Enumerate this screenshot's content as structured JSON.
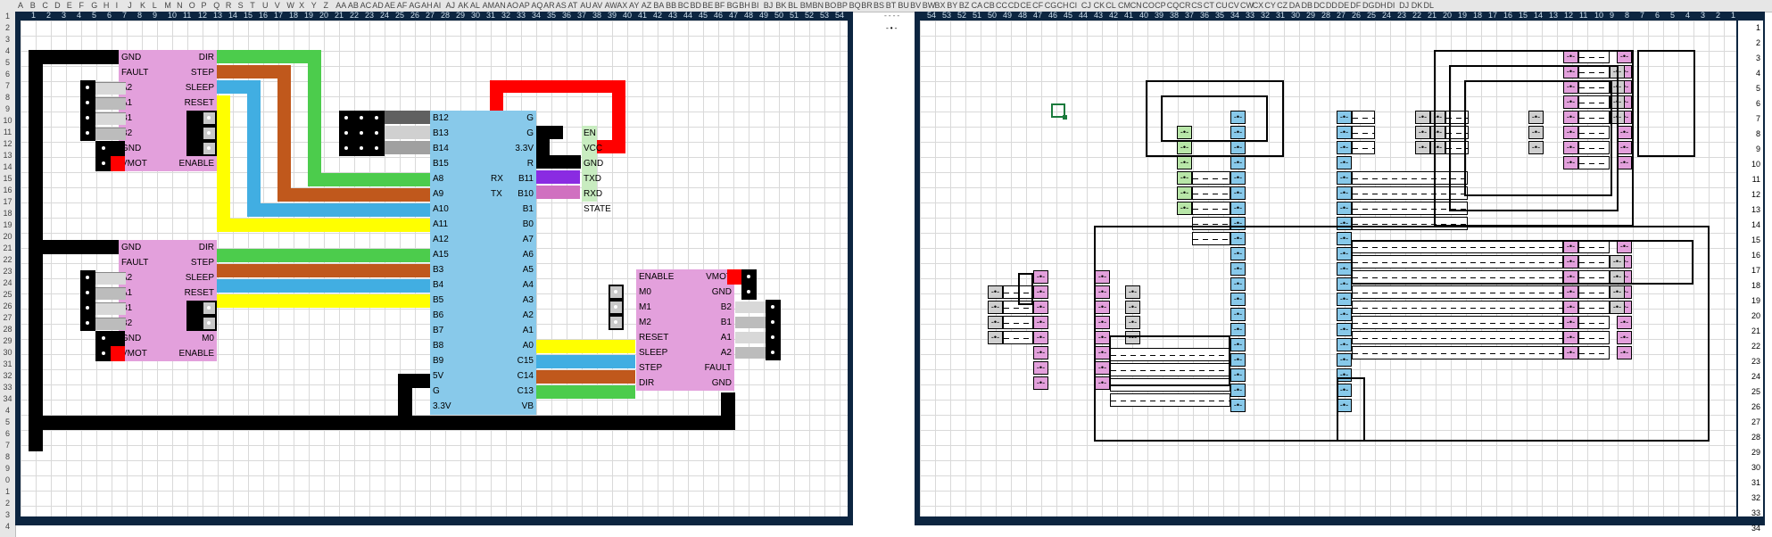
{
  "sheet": {
    "column_headers_text": "A B C D E F G H I J K L M N O P Q R S T U V W X Y Z AA AB AC AD AE AF AG AH AI AJ AK AL AM AN AO AP AQ AR AS AT AU AV AW AX AY AZ BA BB BC BD BE BF BG BH BI BJ BK BL BM BN BO BP BQ BR BS BT BU BV BW BX BY BZ CA CB CC CD CE CF CG CH CI CJ CK CL CM CN CO CP CQ CR CS CT CU CV CW CX CY CZ DA DB DC DD DE DF DG DH DI DJ DK DL",
    "row_headers": [
      "1",
      "2",
      "3",
      "4",
      "5",
      "6",
      "7",
      "8",
      "9",
      "10",
      "11",
      "12",
      "13",
      "14",
      "15",
      "16",
      "17",
      "18",
      "19",
      "20",
      "21",
      "22",
      "23",
      "24",
      "25",
      "26",
      "27",
      "28",
      "29",
      "30",
      "31",
      "32",
      "33",
      "34"
    ],
    "side_cell_text": "----",
    "side_cell_mark": "-•-"
  },
  "left_panel": {
    "numbers": [
      "1",
      "2",
      "3",
      "4",
      "5",
      "6",
      "7",
      "8",
      "9",
      "10",
      "11",
      "12",
      "13",
      "14",
      "15",
      "16",
      "17",
      "18",
      "19",
      "20",
      "21",
      "22",
      "23",
      "24",
      "25",
      "26",
      "27",
      "28",
      "29",
      "30",
      "31",
      "32",
      "33",
      "34",
      "35",
      "36",
      "37",
      "38",
      "39",
      "40",
      "41",
      "42",
      "43",
      "44",
      "45",
      "46",
      "47",
      "48",
      "49",
      "50",
      "51",
      "52",
      "53",
      "54"
    ],
    "driver_top": {
      "left_pins": [
        "GND",
        "FAULT",
        "A2",
        "A1",
        "B1",
        "B2",
        "GND",
        "VMOT"
      ],
      "right_pins": [
        "DIR",
        "STEP",
        "SLEEP",
        "RESET",
        "M2",
        "M1",
        "M0",
        "ENABLE"
      ]
    },
    "driver_bottom": {
      "left_pins": [
        "GND",
        "FAULT",
        "A2",
        "A1",
        "B1",
        "B2",
        "GND",
        "VMOT"
      ],
      "right_pins": [
        "DIR",
        "STEP",
        "SLEEP",
        "RESET",
        "M2",
        "M1",
        "M0",
        "ENABLE"
      ]
    },
    "driver_right": {
      "left_pins": [
        "ENABLE",
        "M0",
        "M1",
        "M2",
        "RESET",
        "SLEEP",
        "STEP",
        "DIR"
      ],
      "right_pins": [
        "VMOT",
        "GND",
        "B2",
        "B1",
        "A1",
        "A2",
        "FAULT",
        "GND"
      ]
    },
    "mcu": {
      "left_pins": [
        "B12",
        "B13",
        "B14",
        "B15",
        "A8",
        "A9",
        "A10",
        "A11",
        "A12",
        "A15",
        "B3",
        "B4",
        "B5",
        "B6",
        "B7",
        "B8",
        "B9",
        "5V",
        "G",
        "3.3V"
      ],
      "right_pins": [
        "G",
        "G",
        "3.3V",
        "R",
        "B11",
        "B10",
        "B1",
        "B0",
        "A7",
        "A6",
        "A5",
        "A4",
        "A3",
        "A2",
        "A1",
        "A0",
        "C15",
        "C14",
        "C13",
        "VB"
      ],
      "rx_label": "RX",
      "tx_label": "TX"
    },
    "bluetooth": {
      "pins": [
        "EN",
        "VCC",
        "GND",
        "TXD",
        "RXD",
        "STATE"
      ]
    }
  },
  "right_panel": {
    "numbers": [
      "54",
      "53",
      "52",
      "51",
      "50",
      "49",
      "48",
      "47",
      "46",
      "45",
      "44",
      "43",
      "42",
      "41",
      "40",
      "39",
      "38",
      "37",
      "36",
      "35",
      "34",
      "33",
      "32",
      "31",
      "30",
      "29",
      "28",
      "27",
      "26",
      "25",
      "24",
      "23",
      "22",
      "21",
      "20",
      "19",
      "18",
      "17",
      "16",
      "15",
      "14",
      "13",
      "12",
      "11",
      "10",
      "9",
      "8",
      "7",
      "6",
      "5",
      "4",
      "3",
      "2",
      "1"
    ],
    "row_numbers": [
      "1",
      "2",
      "3",
      "4",
      "5",
      "6",
      "7",
      "8",
      "9",
      "10",
      "11",
      "12",
      "13",
      "14",
      "15",
      "16",
      "17",
      "18",
      "19",
      "20",
      "21",
      "22",
      "23",
      "24",
      "25",
      "26",
      "27",
      "28",
      "29",
      "30",
      "31",
      "32",
      "33",
      "34"
    ],
    "pin_mark": "-•-"
  },
  "colors": {
    "panel_border": "#0c2540",
    "driver_pink": "#e3a0dc",
    "mcu_blue": "#88c9ea",
    "wire_green": "#4ccc4c",
    "wire_orange": "#c0581c",
    "wire_blue": "#41aee2",
    "wire_yellow": "#ffff00",
    "wire_red": "#ff0000",
    "wire_purple": "#8a2be2",
    "wire_gray": "#606060"
  }
}
